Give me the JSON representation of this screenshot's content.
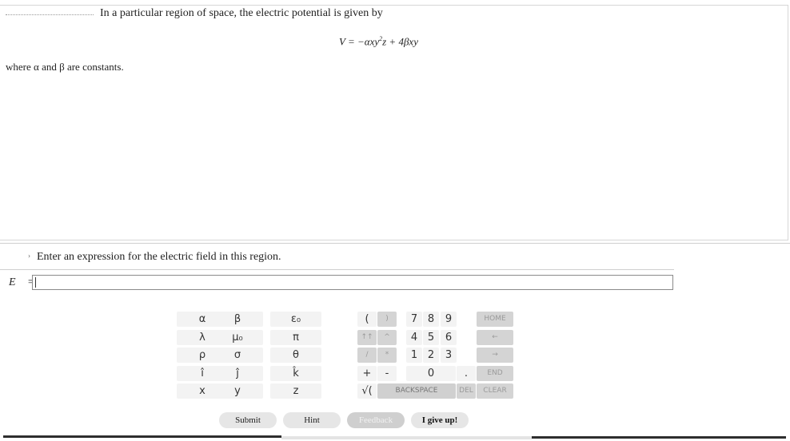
{
  "problem": {
    "intro": "In a particular region of space, the electric potential is given by",
    "equation_lhs": "V = −αxy",
    "equation_sup": "2",
    "equation_rhs": "z + 4βxy",
    "where": "where α and β are constants."
  },
  "part": {
    "marker": "›",
    "prompt": "Enter an expression for the electric field in this region.",
    "field_label": "E⃗ =",
    "answer_value": ""
  },
  "keypad": {
    "symbols": [
      [
        "α",
        "β",
        "ε₀"
      ],
      [
        "λ",
        "μ₀",
        "π"
      ],
      [
        "ρ",
        "σ",
        "θ"
      ],
      [
        "î",
        "ĵ",
        "k̂"
      ],
      [
        "x",
        "y",
        "z"
      ]
    ],
    "ops": [
      [
        "(",
        ")",
        "7",
        "8",
        "9",
        "HOME"
      ],
      [
        "↑↑",
        "^",
        "4",
        "5",
        "6",
        "←"
      ],
      [
        "/",
        "*",
        "1",
        "2",
        "3",
        "→"
      ],
      [
        "+",
        "-",
        "0",
        ".",
        "END"
      ],
      [
        "√(",
        "BACKSPACE",
        "DEL",
        "CLEAR"
      ]
    ]
  },
  "actions": {
    "submit": "Submit",
    "hint": "Hint",
    "feedback": "Feedback",
    "give_up": "I give up!"
  }
}
